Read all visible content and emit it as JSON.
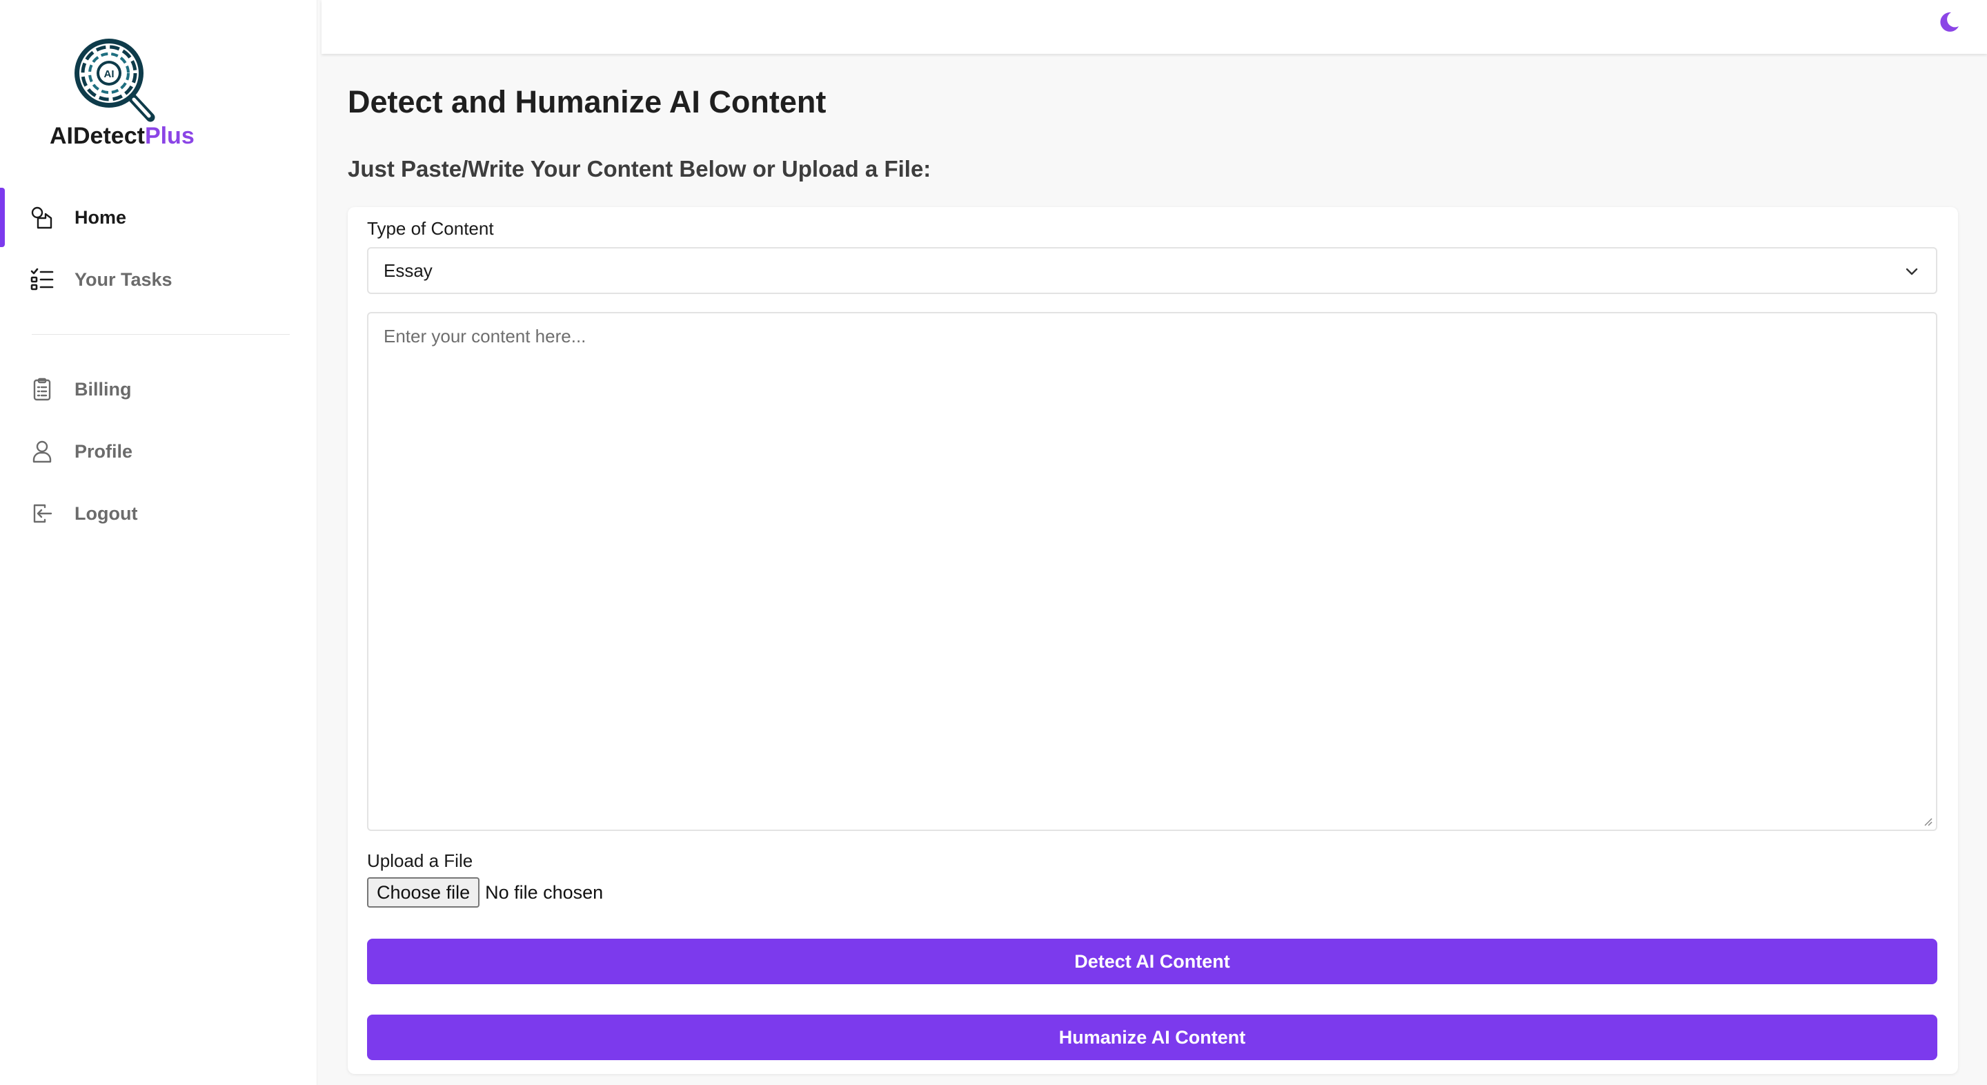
{
  "brand": {
    "name_main": "AIDetect",
    "name_accent": "Plus",
    "logo_mark_text": "AI",
    "accent_color": "#7c3aed"
  },
  "sidebar": {
    "items": [
      {
        "label": "Home",
        "icon": "shapes-icon",
        "active": true
      },
      {
        "label": "Your Tasks",
        "icon": "task-list-icon"
      },
      {
        "label": "Billing",
        "icon": "clipboard-icon"
      },
      {
        "label": "Profile",
        "icon": "user-icon"
      },
      {
        "label": "Logout",
        "icon": "logout-icon"
      }
    ]
  },
  "header": {
    "theme_toggle_icon": "moon-icon"
  },
  "main": {
    "title": "Detect and Humanize AI Content",
    "subtitle": "Just Paste/Write Your Content Below or Upload a File:",
    "content_type_label": "Type of Content",
    "content_type_value": "Essay",
    "content_placeholder": "Enter your content here...",
    "upload_label": "Upload a File",
    "choose_file_label": "Choose file",
    "file_status": "No file chosen",
    "detect_button": "Detect AI Content",
    "humanize_button": "Humanize AI Content"
  }
}
